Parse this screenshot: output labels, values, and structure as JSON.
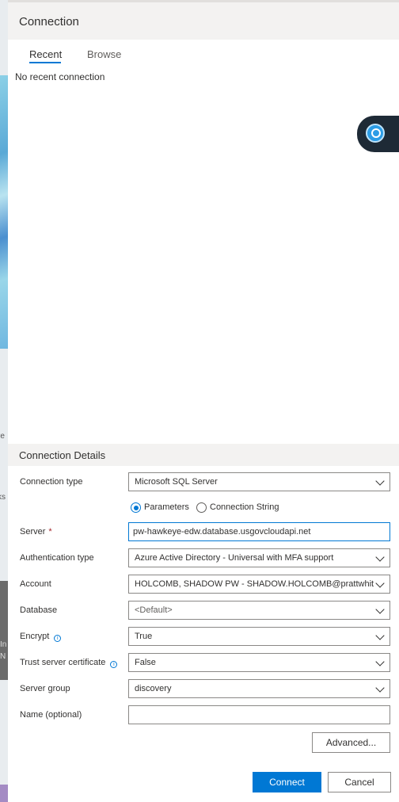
{
  "background": {
    "fragment_1": "re",
    "fragment_2": "ks",
    "fragment_3": "In",
    "fragment_4": "N"
  },
  "header": {
    "title": "Connection"
  },
  "tabs": [
    {
      "label": "Recent",
      "active": true
    },
    {
      "label": "Browse",
      "active": false
    }
  ],
  "recent": {
    "empty_message": "No recent connection"
  },
  "details": {
    "title": "Connection Details",
    "connection_type": {
      "label": "Connection type",
      "value": "Microsoft SQL Server"
    },
    "input_mode": {
      "options": [
        "Parameters",
        "Connection String"
      ],
      "selected": "Parameters"
    },
    "server": {
      "label": "Server",
      "required_mark": "*",
      "value": "pw-hawkeye-edw.database.usgovcloudapi.net"
    },
    "authentication_type": {
      "label": "Authentication type",
      "value": "Azure Active Directory - Universal with MFA support"
    },
    "account": {
      "label": "Account",
      "value": "HOLCOMB, SHADOW PW - SHADOW.HOLCOMB@prattwhitney"
    },
    "database": {
      "label": "Database",
      "value": "<Default>"
    },
    "encrypt": {
      "label": "Encrypt",
      "value": "True"
    },
    "trust_server_certificate": {
      "label": "Trust server certificate",
      "value": "False"
    },
    "server_group": {
      "label": "Server group",
      "value": "discovery"
    },
    "name": {
      "label": "Name (optional)",
      "value": ""
    },
    "advanced_label": "Advanced..."
  },
  "footer": {
    "connect_label": "Connect",
    "cancel_label": "Cancel"
  },
  "colors": {
    "accent": "#0078d4",
    "required": "#a4262c",
    "header_bg": "#f3f2f1"
  }
}
